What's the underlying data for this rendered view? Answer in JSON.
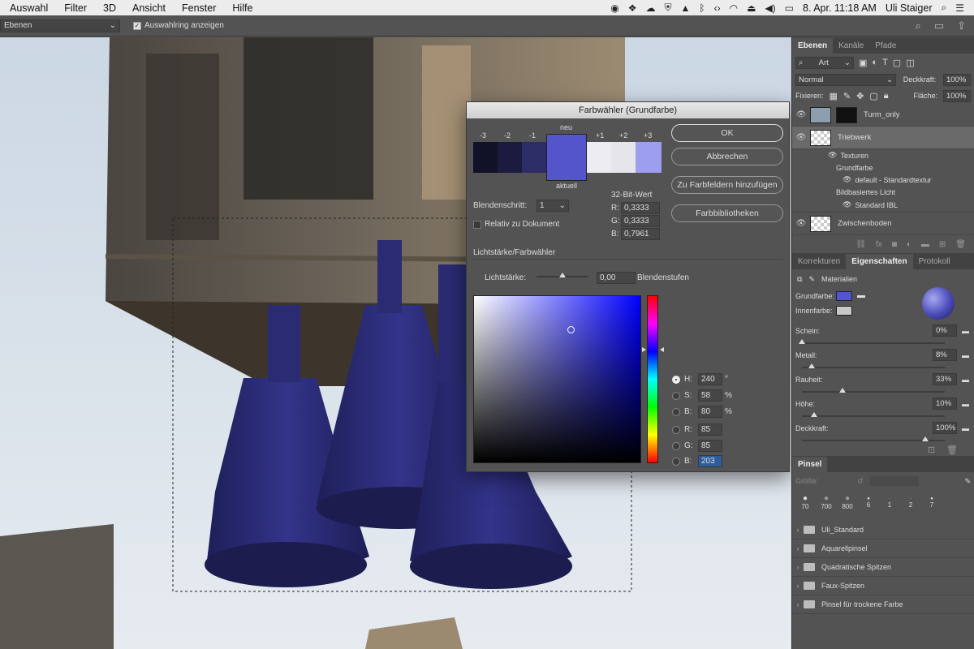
{
  "menubar": {
    "items": [
      "Auswahl",
      "Filter",
      "3D",
      "Ansicht",
      "Fenster",
      "Hilfe"
    ],
    "datetime": "8. Apr. 11:18 AM",
    "user": "Uli Staiger"
  },
  "options_bar": {
    "select_value": "Ebenen",
    "show_ring_label": "Auswahlring anzeigen"
  },
  "dialog": {
    "title": "Farbwähler (Grundfarbe)",
    "swatch_labels": [
      "-3",
      "-2",
      "-1",
      "neu",
      "+1",
      "+2",
      "+3"
    ],
    "swatch_colors": [
      "#111128",
      "#1b1b40",
      "#2c2c66",
      "#5555cb",
      "#ececf2",
      "#e6e6ea",
      "#9e9eef"
    ],
    "current_label": "aktuell",
    "blend_step_label": "Blendenschritt:",
    "blend_step_value": "1",
    "relative_label": "Relativ zu Dokument",
    "bit32_label": "32-Bit-Wert",
    "r32_label": "R:",
    "r32_value": "0,3333",
    "g32_label": "G:",
    "g32_value": "0,3333",
    "b32_label": "B:",
    "b32_value": "0,7961",
    "section_label": "Lichtstärke/Farbwähler",
    "intensity_label": "Lichtstärke:",
    "intensity_value": "0,00",
    "intensity_unit": "Blendenstufen",
    "buttons": {
      "ok": "OK",
      "cancel": "Abbrechen",
      "add_swatches": "Zu Farbfeldern hinzufügen",
      "libraries": "Farbbibliotheken"
    },
    "hsb": {
      "h_label": "H:",
      "h_value": "240",
      "h_unit": "°",
      "s_label": "S:",
      "s_value": "58",
      "s_unit": "%",
      "b_label": "B:",
      "b_value": "80",
      "b_unit": "%"
    },
    "rgb": {
      "r_label": "R:",
      "r_value": "85",
      "g_label": "G:",
      "g_value": "85",
      "b_label": "B:",
      "b_value": "203"
    }
  },
  "layers_panel": {
    "tabs": [
      "Ebenen",
      "Kanäle",
      "Pfade"
    ],
    "filter_label": "Art",
    "blend_mode": "Normal",
    "opacity_label": "Deckkraft:",
    "opacity_value": "100%",
    "lock_label": "Fixieren:",
    "fill_label": "Fläche:",
    "fill_value": "100%",
    "layers": [
      "Turm_only",
      "Triebwerk",
      "Zwischenboden"
    ],
    "sub_items": [
      "Texturen",
      "Grundfarbe",
      "default - Standardtextur",
      "Bildbasiertes Licht",
      "Standard IBL"
    ]
  },
  "properties_panel": {
    "tabs": [
      "Korrekturen",
      "Eigenschaften",
      "Protokoll"
    ],
    "mode_label": "Materialien",
    "base_color_label": "Grundfarbe:",
    "base_color": "#5555cb",
    "inner_color_label": "Innenfarbe:",
    "sliders": [
      {
        "label": "Schein:",
        "value": "0%",
        "level": 0
      },
      {
        "label": "Metall:",
        "value": "8%",
        "level": 8
      },
      {
        "label": "Rauheit:",
        "value": "33%",
        "level": 33
      },
      {
        "label": "Höhe:",
        "value": "10%",
        "level": 10
      },
      {
        "label": "Deckkraft:",
        "value": "100%",
        "level": 100
      }
    ]
  },
  "brush_panel": {
    "tab": "Pinsel",
    "size_label": "Größe:",
    "tips": [
      "70",
      "700",
      "800",
      "6",
      "1",
      "2",
      "7"
    ],
    "folders": [
      "Uli_Standard",
      "Aquarellpinsel",
      "Quadratische Spitzen",
      "Faux-Spitzen",
      "Pinsel für trockene Farbe"
    ]
  }
}
